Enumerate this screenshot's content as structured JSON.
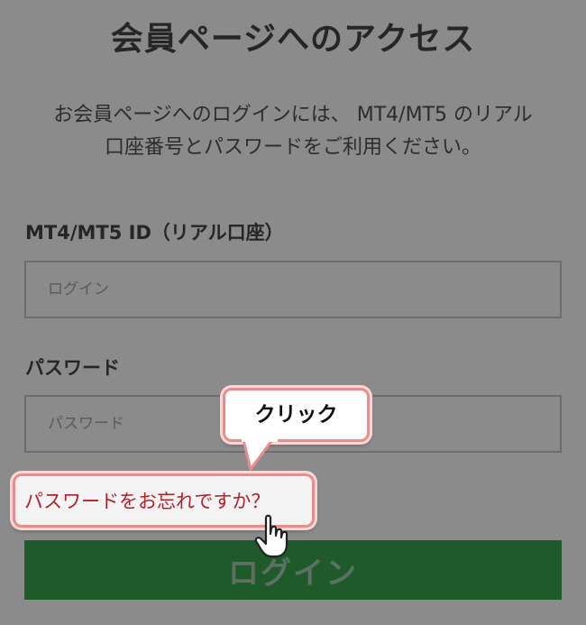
{
  "page_title": "会員ページへのアクセス",
  "description": {
    "line1": "お会員ページへのログインには、 MT4/MT5 のリアル",
    "line2": "口座番号とパスワードをご利用ください。"
  },
  "login_field": {
    "label": "MT4/MT5 ID（リアル口座）",
    "placeholder": "ログイン"
  },
  "password_field": {
    "label": "パスワード",
    "placeholder": "パスワード"
  },
  "forgot_password_label": "パスワードをお忘れですか？",
  "callout_label": "クリック",
  "login_button_label": "ログイン",
  "colors": {
    "overlay": "#8b8b8b",
    "link": "#b3202a",
    "button": "#1f5a2a",
    "highlight_border": "#ea8c8c"
  },
  "icons": [
    "pointer-hand-icon"
  ]
}
